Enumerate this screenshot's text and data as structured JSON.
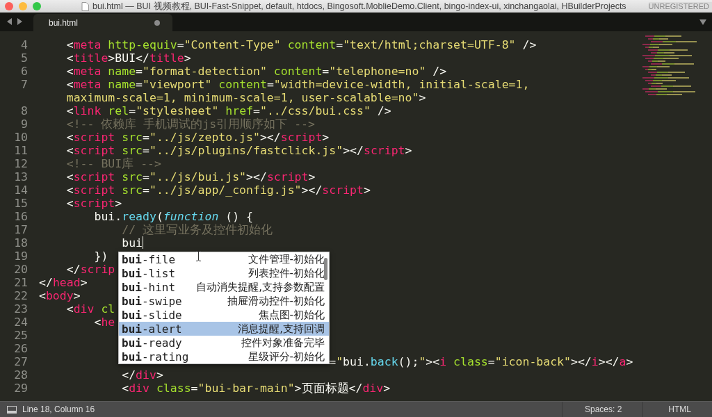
{
  "window": {
    "title": "bui.html — BUI 视频教程, BUI-Fast-Snippet, default, htdocs, Bingosoft.MoblieDemo.Client, bingo-index-ui, xinchangaolai, HBuilderProjects",
    "badge": "UNREGISTERED"
  },
  "tabs": [
    {
      "label": "bui.html",
      "selected": true,
      "modified": true
    }
  ],
  "editor": {
    "lines": [
      {
        "number": "4",
        "tokens": [
          {
            "kind": "p",
            "text": "    <"
          },
          {
            "kind": "tag",
            "text": "meta"
          },
          {
            "kind": "attr",
            "text": " http-equiv"
          },
          {
            "kind": "p",
            "text": "="
          },
          {
            "kind": "str",
            "text": "\"Content-Type\""
          },
          {
            "kind": "attr",
            "text": " content"
          },
          {
            "kind": "p",
            "text": "="
          },
          {
            "kind": "str",
            "text": "\"text/html;charset=UTF-8\""
          },
          {
            "kind": "p",
            "text": " />"
          }
        ]
      },
      {
        "number": "5",
        "tokens": [
          {
            "kind": "p",
            "text": "    <"
          },
          {
            "kind": "tag",
            "text": "title"
          },
          {
            "kind": "p",
            "text": ">BUI</"
          },
          {
            "kind": "tag",
            "text": "title"
          },
          {
            "kind": "p",
            "text": ">"
          }
        ]
      },
      {
        "number": "6",
        "tokens": [
          {
            "kind": "p",
            "text": "    <"
          },
          {
            "kind": "tag",
            "text": "meta"
          },
          {
            "kind": "attr",
            "text": " name"
          },
          {
            "kind": "p",
            "text": "="
          },
          {
            "kind": "str",
            "text": "\"format-detection\""
          },
          {
            "kind": "attr",
            "text": " content"
          },
          {
            "kind": "p",
            "text": "="
          },
          {
            "kind": "str",
            "text": "\"telephone=no\""
          },
          {
            "kind": "p",
            "text": " />"
          }
        ]
      },
      {
        "number": "7",
        "tokens": [
          {
            "kind": "p",
            "text": "    <"
          },
          {
            "kind": "tag",
            "text": "meta"
          },
          {
            "kind": "attr",
            "text": " name"
          },
          {
            "kind": "p",
            "text": "="
          },
          {
            "kind": "str",
            "text": "\"viewport\""
          },
          {
            "kind": "attr",
            "text": " content"
          },
          {
            "kind": "p",
            "text": "="
          },
          {
            "kind": "str",
            "text": "\"width=device-width, initial-scale=1,"
          }
        ]
      },
      {
        "tokens": [
          {
            "kind": "str",
            "text": "    maximum-scale=1, minimum-scale=1, user-scalable=no\""
          },
          {
            "kind": "p",
            "text": ">"
          }
        ]
      },
      {
        "number": "8",
        "tokens": [
          {
            "kind": "p",
            "text": "    <"
          },
          {
            "kind": "tag",
            "text": "link"
          },
          {
            "kind": "attr",
            "text": " rel"
          },
          {
            "kind": "p",
            "text": "="
          },
          {
            "kind": "str",
            "text": "\"stylesheet\""
          },
          {
            "kind": "attr",
            "text": " href"
          },
          {
            "kind": "p",
            "text": "="
          },
          {
            "kind": "str",
            "text": "\"../css/bui.css\""
          },
          {
            "kind": "p",
            "text": " />"
          }
        ]
      },
      {
        "number": "9",
        "tokens": [
          {
            "kind": "cm",
            "text": "    <!-- 依赖库 手机调试的js引用顺序如下 -->"
          }
        ]
      },
      {
        "number": "10",
        "tokens": [
          {
            "kind": "p",
            "text": "    <"
          },
          {
            "kind": "tag",
            "text": "script"
          },
          {
            "kind": "attr",
            "text": " src"
          },
          {
            "kind": "p",
            "text": "="
          },
          {
            "kind": "str",
            "text": "\"../js/zepto.js\""
          },
          {
            "kind": "p",
            "text": "></"
          },
          {
            "kind": "tag",
            "text": "script"
          },
          {
            "kind": "p",
            "text": ">"
          }
        ]
      },
      {
        "number": "11",
        "tokens": [
          {
            "kind": "p",
            "text": "    <"
          },
          {
            "kind": "tag",
            "text": "script"
          },
          {
            "kind": "attr",
            "text": " src"
          },
          {
            "kind": "p",
            "text": "="
          },
          {
            "kind": "str",
            "text": "\"../js/plugins/fastclick.js\""
          },
          {
            "kind": "p",
            "text": "></"
          },
          {
            "kind": "tag",
            "text": "script"
          },
          {
            "kind": "p",
            "text": ">"
          }
        ]
      },
      {
        "number": "12",
        "tokens": [
          {
            "kind": "cm",
            "text": "    <!-- BUI库 -->"
          }
        ]
      },
      {
        "number": "13",
        "tokens": [
          {
            "kind": "p",
            "text": "    <"
          },
          {
            "kind": "tag",
            "text": "script"
          },
          {
            "kind": "attr",
            "text": " src"
          },
          {
            "kind": "p",
            "text": "="
          },
          {
            "kind": "str",
            "text": "\"../js/bui.js\""
          },
          {
            "kind": "p",
            "text": "></"
          },
          {
            "kind": "tag",
            "text": "script"
          },
          {
            "kind": "p",
            "text": ">"
          }
        ]
      },
      {
        "number": "14",
        "tokens": [
          {
            "kind": "p",
            "text": "    <"
          },
          {
            "kind": "tag",
            "text": "script"
          },
          {
            "kind": "attr",
            "text": " src"
          },
          {
            "kind": "p",
            "text": "="
          },
          {
            "kind": "str",
            "text": "\"../js/app/_config.js\""
          },
          {
            "kind": "p",
            "text": "></"
          },
          {
            "kind": "tag",
            "text": "script"
          },
          {
            "kind": "p",
            "text": ">"
          }
        ]
      },
      {
        "number": "15",
        "tokens": [
          {
            "kind": "p",
            "text": "    <"
          },
          {
            "kind": "tag",
            "text": "script"
          },
          {
            "kind": "p",
            "text": ">"
          }
        ]
      },
      {
        "number": "16",
        "tokens": [
          {
            "kind": "p",
            "text": "        bui."
          },
          {
            "kind": "fn",
            "text": "ready"
          },
          {
            "kind": "p",
            "text": "("
          },
          {
            "kind": "kw",
            "text": "function"
          },
          {
            "kind": "p",
            "text": " () {"
          }
        ]
      },
      {
        "number": "17",
        "tokens": [
          {
            "kind": "cm",
            "text": "            // 这里写业务及控件初始化"
          }
        ]
      },
      {
        "number": "18",
        "cursor": true,
        "tokens": [
          {
            "kind": "p",
            "text": "            bui"
          }
        ]
      },
      {
        "number": "19",
        "tokens": [
          {
            "kind": "p",
            "text": "        })"
          }
        ]
      },
      {
        "number": "20",
        "tokens": [
          {
            "kind": "p",
            "text": "    </"
          },
          {
            "kind": "tag",
            "text": "scrip"
          }
        ]
      },
      {
        "number": "21",
        "tokens": [
          {
            "kind": "p",
            "text": "</"
          },
          {
            "kind": "tag",
            "text": "head"
          },
          {
            "kind": "p",
            "text": ">"
          }
        ]
      },
      {
        "number": "22",
        "tokens": [
          {
            "kind": "p",
            "text": "<"
          },
          {
            "kind": "tag",
            "text": "body"
          },
          {
            "kind": "p",
            "text": ">"
          }
        ]
      },
      {
        "number": "23",
        "tokens": [
          {
            "kind": "p",
            "text": "    <"
          },
          {
            "kind": "tag",
            "text": "div"
          },
          {
            "kind": "attr",
            "text": " cl"
          }
        ]
      },
      {
        "number": "24",
        "tokens": [
          {
            "kind": "p",
            "text": "        <"
          },
          {
            "kind": "tag",
            "text": "he"
          }
        ]
      },
      {
        "number": "25"
      },
      {
        "number": "26"
      },
      {
        "number": "27",
        "tokens": [
          {
            "kind": "p",
            "text": "                                          ="
          },
          {
            "kind": "str",
            "text": "\""
          },
          {
            "kind": "p",
            "text": "bui."
          },
          {
            "kind": "fn",
            "text": "back"
          },
          {
            "kind": "p",
            "text": "();"
          },
          {
            "kind": "str",
            "text": "\""
          },
          {
            "kind": "p",
            "text": "><"
          },
          {
            "kind": "tag",
            "text": "i"
          },
          {
            "kind": "attr",
            "text": " class"
          },
          {
            "kind": "p",
            "text": "="
          },
          {
            "kind": "str",
            "text": "\"icon-back\""
          },
          {
            "kind": "p",
            "text": "></"
          },
          {
            "kind": "tag",
            "text": "i"
          },
          {
            "kind": "p",
            "text": "></"
          },
          {
            "kind": "tag",
            "text": "a"
          },
          {
            "kind": "p",
            "text": ">"
          }
        ]
      },
      {
        "number": "28",
        "tokens": [
          {
            "kind": "p",
            "text": "            </"
          },
          {
            "kind": "tag",
            "text": "div"
          },
          {
            "kind": "p",
            "text": ">"
          }
        ]
      },
      {
        "number": "29",
        "tokens": [
          {
            "kind": "p",
            "text": "            <"
          },
          {
            "kind": "tag",
            "text": "div"
          },
          {
            "kind": "attr",
            "text": " class"
          },
          {
            "kind": "p",
            "text": "="
          },
          {
            "kind": "str",
            "text": "\"bui-bar-main\""
          },
          {
            "kind": "p",
            "text": ">页面标题</"
          },
          {
            "kind": "tag",
            "text": "div"
          },
          {
            "kind": "p",
            "text": ">"
          }
        ]
      }
    ]
  },
  "autocomplete": [
    {
      "label": "**bui**-file",
      "hint": "文件管理-初始化",
      "selected": false
    },
    {
      "label": "**bui**-list",
      "hint": "列表控件-初始化",
      "selected": false
    },
    {
      "label": "**bui**-hint",
      "hint": "自动消失提醒,支持参数配置",
      "selected": false
    },
    {
      "label": "**bui**-swipe",
      "hint": "抽屉滑动控件-初始化",
      "selected": false
    },
    {
      "label": "**bui**-slide",
      "hint": "焦点图-初始化",
      "selected": false
    },
    {
      "label": "**bui**-alert",
      "hint": "消息提醒,支持回调",
      "selected": true
    },
    {
      "label": "**bui**-ready",
      "hint": "控件对象准备完毕",
      "selected": false
    },
    {
      "label": "**bui**-rating",
      "hint": "星级评分-初始化",
      "selected": false
    }
  ],
  "status_bar": {
    "position": "Line 18, Column 16",
    "indentation": "Spaces: 2",
    "syntax": "HTML"
  }
}
